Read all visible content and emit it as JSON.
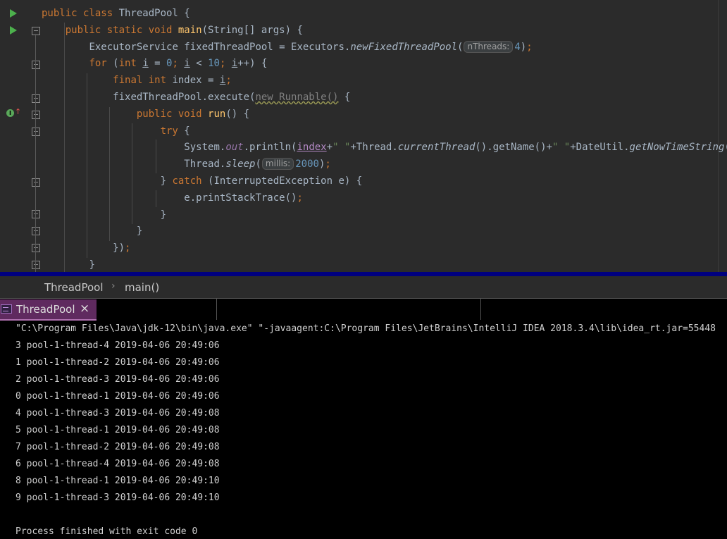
{
  "editor": {
    "code": {
      "l1": {
        "kw": "public class ",
        "cls": "ThreadPool",
        "rest": " {"
      },
      "l2": {
        "kw": "public static void ",
        "fn": "main",
        "rest": "(String[] args) {"
      },
      "l3": {
        "a": "ExecutorService fixedThreadPool = Executors.",
        "call": "newFixedThreadPool",
        "b": "(",
        "hint": "nThreads:",
        "num": "4",
        "c": ")",
        "semi": ";"
      },
      "l4": {
        "kw": "for ",
        "a": "(",
        "kw2": "int ",
        "v1": "i",
        "b": " = ",
        "n0": "0",
        "s1": "; ",
        "v2": "i",
        "c": " < ",
        "n10": "10",
        "s2": "; ",
        "v3": "i",
        "d": "++) {"
      },
      "l5": {
        "kw": "final int ",
        "a": "index = ",
        "v": "i",
        "semi": ";"
      },
      "l6": {
        "a": "fixedThreadPool.execute(",
        "wavy": "new Runnable()",
        "b": " {"
      },
      "l7": {
        "kw": "public void ",
        "fn": "run",
        "rest": "() {"
      },
      "l8": {
        "kw": "try",
        "rest": " {"
      },
      "l9": {
        "a": "System.",
        "out": "out",
        "b": ".println(",
        "index": "index",
        "c": "+",
        "s1": "\" \"",
        "d": "+Thread.",
        "ct": "currentThread",
        "e": "().getName()+",
        "s2": "\" \"",
        "f": "+DateUtil.",
        "gn": "getNowTimeString",
        "g": "())",
        "semi": ";"
      },
      "l10": {
        "a": "Thread.",
        "sl": "sleep",
        "b": "(",
        "hint": "millis:",
        "num": "2000",
        "c": ")",
        "semi": ";"
      },
      "l11": {
        "a": "} ",
        "kw": "catch",
        "rest": " (InterruptedException e) {"
      },
      "l12": {
        "a": "e.printStackTrace()",
        "semi": ";"
      },
      "l13": "}",
      "l14": "}",
      "l15": {
        "a": "})",
        "semi": ";"
      },
      "l16": "}"
    }
  },
  "breadcrumb": {
    "items": [
      "ThreadPool",
      "main()"
    ],
    "sep": "›"
  },
  "run_tab": {
    "label": "ThreadPool",
    "close": "×"
  },
  "console": {
    "lines": [
      "\"C:\\Program Files\\Java\\jdk-12\\bin\\java.exe\" \"-javaagent:C:\\Program Files\\JetBrains\\IntelliJ IDEA 2018.3.4\\lib\\idea_rt.jar=55448",
      "3 pool-1-thread-4 2019-04-06 20:49:06",
      "1 pool-1-thread-2 2019-04-06 20:49:06",
      "2 pool-1-thread-3 2019-04-06 20:49:06",
      "0 pool-1-thread-1 2019-04-06 20:49:06",
      "4 pool-1-thread-3 2019-04-06 20:49:08",
      "5 pool-1-thread-1 2019-04-06 20:49:08",
      "7 pool-1-thread-2 2019-04-06 20:49:08",
      "6 pool-1-thread-4 2019-04-06 20:49:08",
      "8 pool-1-thread-1 2019-04-06 20:49:10",
      "9 pool-1-thread-3 2019-04-06 20:49:10",
      "",
      "Process finished with exit code 0"
    ]
  },
  "icons": {
    "run": "run-gutter-icon",
    "fold": "fold-marker-icon",
    "override": "override-method-icon",
    "run_tab": "run-console-icon",
    "close": "close-icon"
  },
  "colors": {
    "editor_bg": "#2b2b2b",
    "keyword": "#cc7832",
    "function": "#ffc66d",
    "number": "#6897bb",
    "string": "#6a8759",
    "static_field": "#9876aa",
    "console_bg": "#000000",
    "tab_active": "#5f2a5f",
    "divider": "#000080"
  }
}
